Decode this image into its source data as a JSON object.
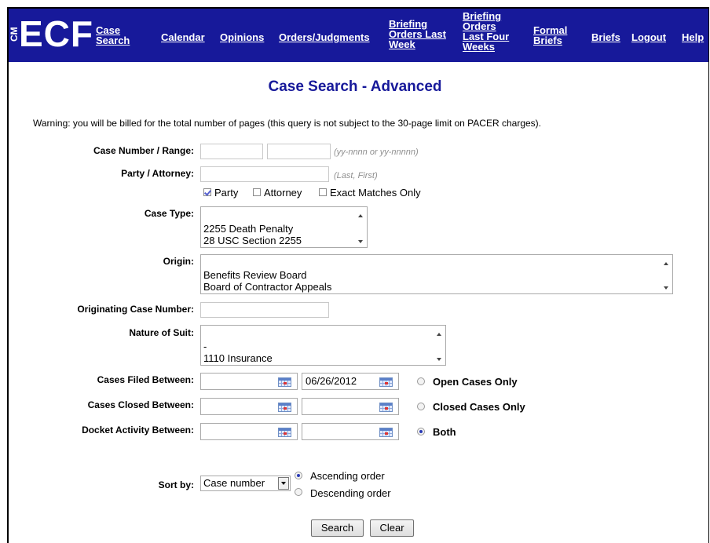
{
  "nav": {
    "logo_cm": "CM",
    "logo_ecf": "ECF",
    "links": [
      {
        "label": "Case Search"
      },
      {
        "label": "Calendar"
      },
      {
        "label": "Opinions"
      },
      {
        "label": "Orders/Judgments"
      },
      {
        "label": "Briefing Orders Last Week"
      },
      {
        "label": "Briefing Orders Last Four Weeks"
      },
      {
        "label": "Formal Briefs"
      },
      {
        "label": "Briefs"
      },
      {
        "label": "Logout"
      },
      {
        "label": "Help"
      }
    ]
  },
  "page": {
    "title": "Case Search - Advanced",
    "warning": "Warning: you will be billed for the total number of pages (this query is not subject to the 30-page limit on PACER charges)."
  },
  "form": {
    "case_number": {
      "label": "Case Number / Range:",
      "from": "",
      "to": "",
      "hint": "(yy-nnnn or yy-nnnnn)"
    },
    "party": {
      "label": "Party / Attorney:",
      "value": "",
      "hint": "(Last, First)"
    },
    "party_options": [
      {
        "label": "Party",
        "checked": true
      },
      {
        "label": "Attorney",
        "checked": false
      },
      {
        "label": "Exact Matches Only",
        "checked": false
      }
    ],
    "case_type": {
      "label": "Case Type:",
      "options": [
        "2255 Death Penalty",
        "28 USC Section 2255"
      ]
    },
    "origin": {
      "label": "Origin:",
      "options": [
        "Benefits Review Board",
        "Board of Contractor Appeals"
      ]
    },
    "originating_case": {
      "label": "Originating Case Number:",
      "value": ""
    },
    "nature_of_suit": {
      "label": "Nature of Suit:",
      "options": [
        "-",
        "1110 Insurance"
      ]
    },
    "filed_between": {
      "label": "Cases Filed Between:",
      "from": "",
      "to": "06/26/2012"
    },
    "closed_between": {
      "label": "Cases Closed Between:",
      "from": "",
      "to": ""
    },
    "docket_between": {
      "label": "Docket Activity Between:",
      "from": "",
      "to": ""
    },
    "status_options": [
      {
        "label": "Open Cases Only",
        "selected": false
      },
      {
        "label": "Closed Cases Only",
        "selected": false
      },
      {
        "label": "Both",
        "selected": true
      }
    ],
    "sort": {
      "label": "Sort by:",
      "value": "Case number"
    },
    "order_options": [
      {
        "label": "Ascending order",
        "selected": true
      },
      {
        "label": "Descending order",
        "selected": false
      }
    ],
    "search_label": "Search",
    "clear_label": "Clear"
  },
  "colors": {
    "nav_bg": "#17199a",
    "title": "#17199a"
  }
}
